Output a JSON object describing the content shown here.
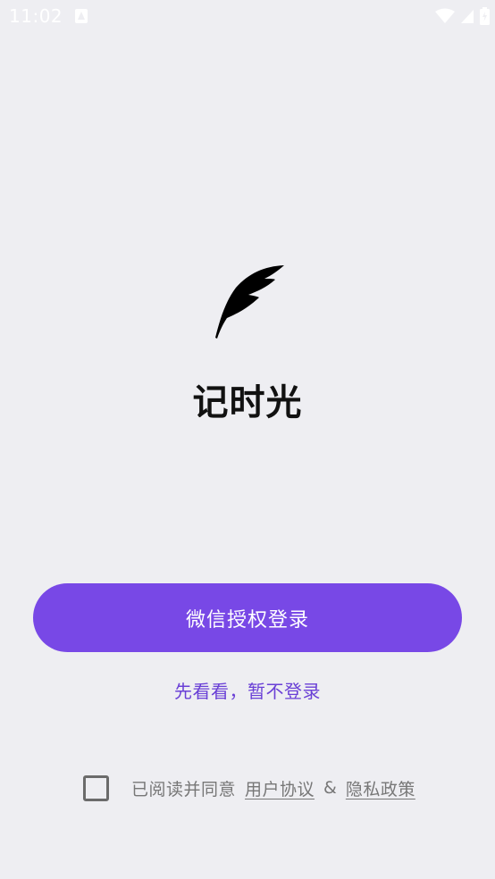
{
  "status_bar": {
    "time": "11:02",
    "icons": [
      "notification-icon",
      "wifi-icon",
      "signal-icon",
      "battery-icon"
    ]
  },
  "app": {
    "logo_icon": "feather-icon",
    "name": "记时光"
  },
  "actions": {
    "wechat_login_label": "微信授权登录",
    "skip_label": "先看看，暂不登录"
  },
  "agreement": {
    "checked": false,
    "prefix": "已阅读并同意",
    "user_agreement": "用户协议",
    "separator": "&",
    "privacy_policy": "隐私政策"
  },
  "colors": {
    "background": "#EEEEF2",
    "accent": "#7848E6",
    "accent_text": "#6A40D6",
    "muted_text": "#777777"
  }
}
